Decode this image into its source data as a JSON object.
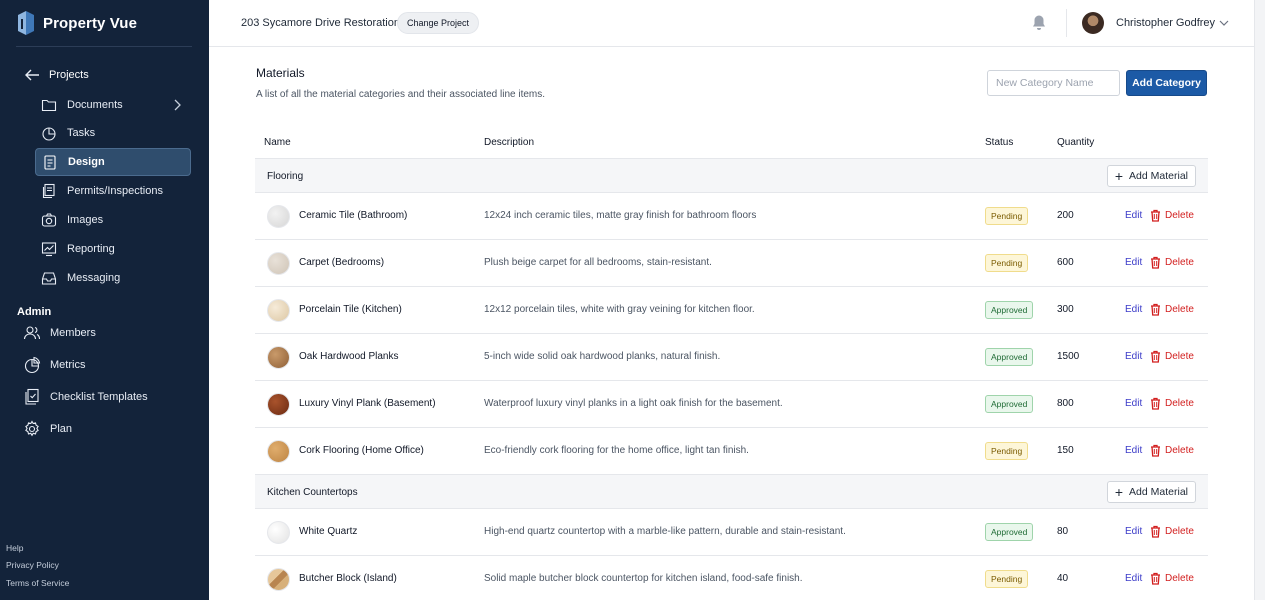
{
  "app": {
    "name": "Property Vue"
  },
  "colors": {
    "sidebar_bg": "#13233a",
    "accent": "#1c5aa6",
    "danger": "#d21f1f",
    "link": "#3b3bc8"
  },
  "sidebar": {
    "back_label": "Projects",
    "items": [
      {
        "label": "Documents",
        "icon": "folder-icon"
      },
      {
        "label": "Tasks",
        "icon": "pie-chart-icon"
      },
      {
        "label": "Design",
        "icon": "clipboard-icon",
        "active": true
      },
      {
        "label": "Permits/Inspections",
        "icon": "documents-icon"
      },
      {
        "label": "Images",
        "icon": "camera-icon"
      },
      {
        "label": "Reporting",
        "icon": "line-chart-icon"
      },
      {
        "label": "Messaging",
        "icon": "inbox-icon"
      }
    ],
    "admin_label": "Admin",
    "admin_items": [
      {
        "label": "Members",
        "icon": "users-icon"
      },
      {
        "label": "Metrics",
        "icon": "pie-chart-icon"
      },
      {
        "label": "Checklist Templates",
        "icon": "checklist-icon"
      },
      {
        "label": "Plan",
        "icon": "gear-icon"
      }
    ],
    "footer": [
      "Help",
      "Privacy Policy",
      "Terms of Service"
    ]
  },
  "header": {
    "project_name": "203 Sycamore Drive Restoration",
    "change_project_label": "Change Project",
    "user_name": "Christopher Godfrey"
  },
  "main": {
    "title": "Materials",
    "description": "A list of all the material categories and their associated line items.",
    "new_category_placeholder": "New Category Name",
    "add_category_label": "Add Category",
    "columns": {
      "name": "Name",
      "description": "Description",
      "status": "Status",
      "quantity": "Quantity"
    },
    "add_material_label": "Add Material",
    "edit_label": "Edit",
    "delete_label": "Delete",
    "categories": [
      {
        "name": "Flooring",
        "items": [
          {
            "name": "Ceramic Tile (Bathroom)",
            "description": "12x24 inch ceramic tiles, matte gray finish for bathroom floors",
            "status": "Pending",
            "quantity": "200"
          },
          {
            "name": "Carpet (Bedrooms)",
            "description": "Plush beige carpet for all bedrooms, stain-resistant.",
            "status": "Pending",
            "quantity": "600"
          },
          {
            "name": "Porcelain Tile (Kitchen)",
            "description": "12x12 porcelain tiles, white with gray veining for kitchen floor.",
            "status": "Approved",
            "quantity": "300"
          },
          {
            "name": "Oak Hardwood Planks",
            "description": "5-inch wide solid oak hardwood planks, natural finish.",
            "status": "Approved",
            "quantity": "1500"
          },
          {
            "name": "Luxury Vinyl Plank (Basement)",
            "description": "Waterproof luxury vinyl planks in a light oak finish for the basement.",
            "status": "Approved",
            "quantity": "800"
          },
          {
            "name": "Cork Flooring (Home Office)",
            "description": "Eco-friendly cork flooring for the home office, light tan finish.",
            "status": "Pending",
            "quantity": "150"
          }
        ]
      },
      {
        "name": "Kitchen Countertops",
        "items": [
          {
            "name": "White Quartz",
            "description": "High-end quartz countertop with a marble-like pattern, durable and stain-resistant.",
            "status": "Approved",
            "quantity": "80"
          },
          {
            "name": "Butcher Block (Island)",
            "description": "Solid maple butcher block countertop for kitchen island, food-safe finish.",
            "status": "Pending",
            "quantity": "40"
          }
        ]
      }
    ]
  }
}
